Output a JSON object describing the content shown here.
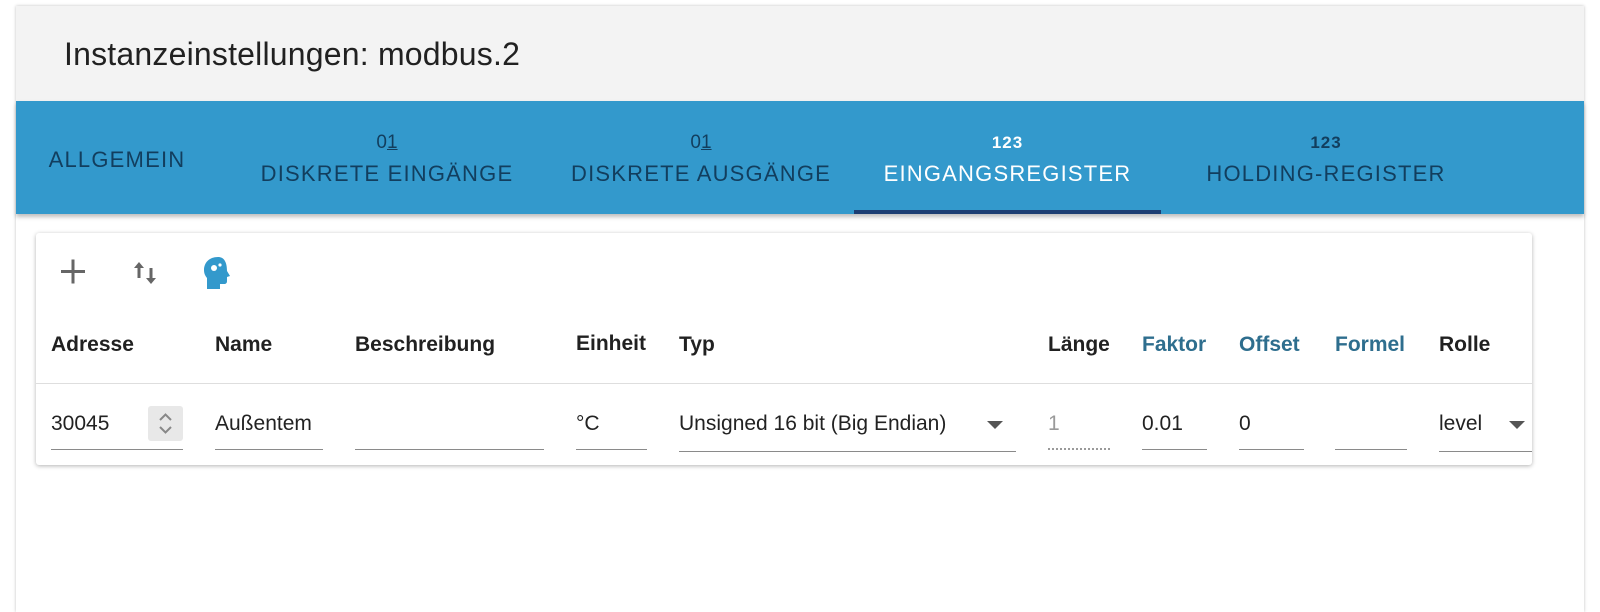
{
  "header": {
    "title": "Instanzeinstellungen: modbus.2"
  },
  "tabs": [
    {
      "icon": "",
      "label": "ALLGEMEIN"
    },
    {
      "icon": "01",
      "label": "DISKRETE EINGÄNGE"
    },
    {
      "icon": "01",
      "label": "DISKRETE AUSGÄNGE"
    },
    {
      "icon": "123",
      "label": "EINGANGSREGISTER"
    },
    {
      "icon": "123",
      "label": "HOLDING-REGISTER"
    }
  ],
  "active_tab": "EINGANGSREGISTER",
  "toolbar": {
    "add_icon": "add-icon",
    "import_export_icon": "import-export-icon",
    "autodetect_icon": "brain-head-icon",
    "accent": "#3399cc"
  },
  "table": {
    "columns": [
      "Adresse",
      "Name",
      "Beschreibung",
      "Einheit",
      "Typ",
      "Länge",
      "Faktor",
      "Offset",
      "Formel",
      "Rolle"
    ],
    "rows": [
      {
        "adresse": "30045",
        "name": "Außentem",
        "beschreibung": "",
        "einheit": "°C",
        "typ": "Unsigned 16 bit (Big Endian)",
        "laenge": "1",
        "faktor": "0.01",
        "offset": "0",
        "formel": "",
        "rolle": "level"
      }
    ]
  },
  "colors": {
    "tabbar": "#3399cc",
    "active_text": "#ffffff",
    "inactive_text": "#123e5e",
    "indicator": "#1c3e73",
    "link_header": "#2e6e8e"
  }
}
